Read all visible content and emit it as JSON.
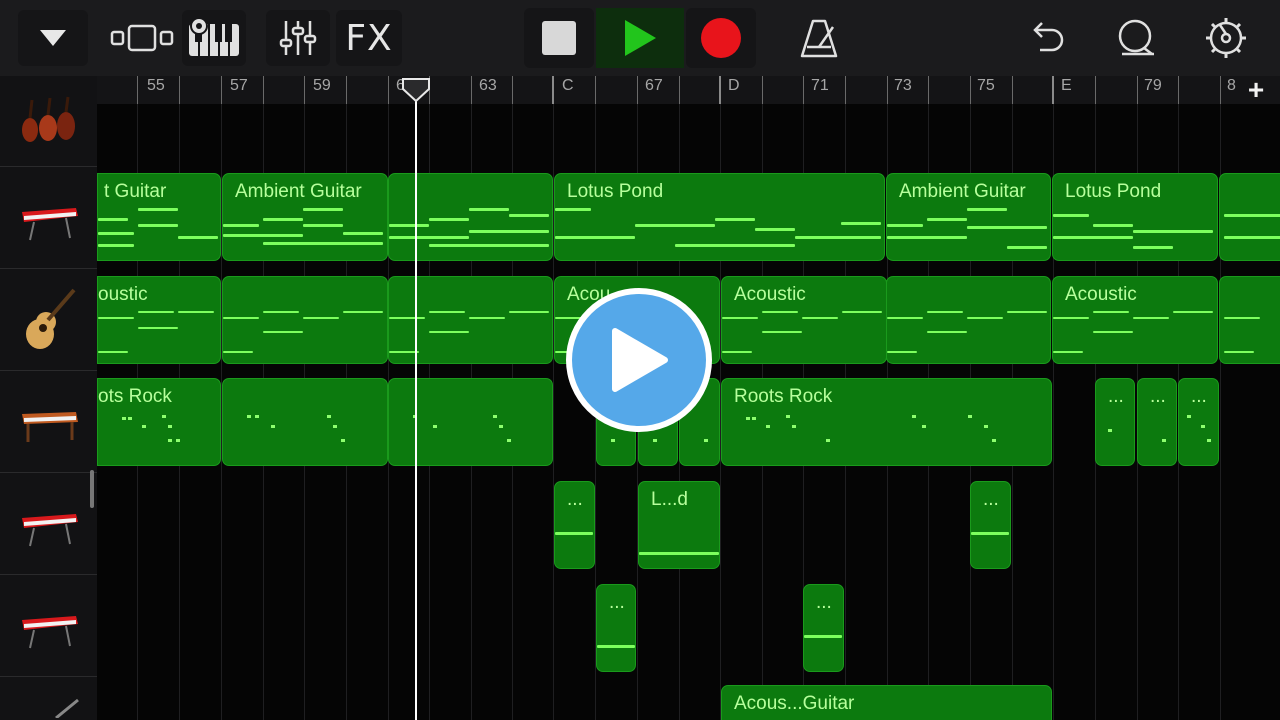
{
  "toolbar": {
    "fx_label": "FX",
    "icons": [
      "dropdown-triangle-icon",
      "browser-view-icon",
      "keyboard-icon",
      "mixer-icon",
      "fx",
      "stop-icon",
      "play-icon",
      "record-icon",
      "metronome-icon",
      "undo-icon",
      "loop-icon",
      "settings-gear-icon"
    ]
  },
  "ruler": {
    "bars": [
      "55",
      "57",
      "59",
      "61",
      "63",
      "67",
      "71",
      "73",
      "75",
      "79",
      "8"
    ],
    "sections": [
      "C",
      "D",
      "E"
    ]
  },
  "tracks": [
    {
      "instrument": "strings",
      "icon": "violin-ensemble-icon"
    },
    {
      "instrument": "keyboard-red",
      "icon": "red-keyboard-icon"
    },
    {
      "instrument": "acoustic-guitar",
      "icon": "acoustic-guitar-icon"
    },
    {
      "instrument": "organ",
      "icon": "organ-icon"
    },
    {
      "instrument": "keyboard-red-2",
      "icon": "red-keyboard-icon"
    },
    {
      "instrument": "keyboard-red-3",
      "icon": "red-keyboard-icon"
    },
    {
      "instrument": "guitar-neck",
      "icon": "guitar-icon"
    }
  ],
  "regions": {
    "t1_r1": "t Guitar",
    "t1_r2": "Ambient Guitar",
    "t1_r4": "Lotus Pond",
    "t1_r5": "Ambient Guitar",
    "t1_r6": "Lotus Pond",
    "t2_r1": "oustic",
    "t2_r4": "Acou",
    "t2_r5": "Acoustic",
    "t2_r7": "Acoustic",
    "t3_r1": "ots Rock",
    "t3_r6": "Roots Rock",
    "t3_s1": "...",
    "t3_s2": "...",
    "t3_s3": "...",
    "t4_r1": "...",
    "t4_r2": "L...d",
    "t4_r3": "...",
    "t5_r1": "...",
    "t5_r2": "...",
    "t6_r1": "Acous...Guitar"
  },
  "colors": {
    "region_fill": "#0c7a0e",
    "note": "#7dff5e",
    "label": "#b7ff9c",
    "play_green": "#22c51c",
    "record_red": "#e8141b",
    "overlay_blue": "#55a8e9"
  }
}
